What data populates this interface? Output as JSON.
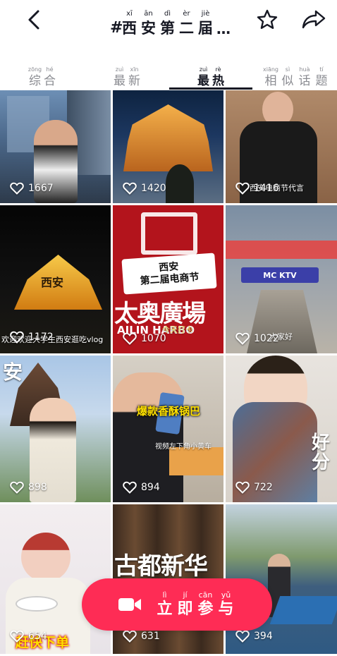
{
  "header": {
    "title": [
      {
        "py": "xī",
        "hz": "西"
      },
      {
        "py": "ān",
        "hz": "安"
      },
      {
        "py": "dì",
        "hz": "第"
      },
      {
        "py": "èr",
        "hz": "二"
      },
      {
        "py": "jiè",
        "hz": "届"
      }
    ],
    "hash": "#",
    "ellipsis": "…"
  },
  "tabs": [
    {
      "chars": [
        {
          "py": "zōng",
          "hz": "综"
        },
        {
          "py": "hé",
          "hz": "合"
        }
      ]
    },
    {
      "chars": [
        {
          "py": "zuì",
          "hz": "最"
        },
        {
          "py": "xīn",
          "hz": "新"
        }
      ]
    },
    {
      "chars": [
        {
          "py": "zuì",
          "hz": "最"
        },
        {
          "py": "rè",
          "hz": "热"
        }
      ],
      "active": true
    },
    {
      "chars": [
        {
          "py": "xiāng",
          "hz": "相"
        },
        {
          "py": "sì",
          "hz": "似"
        },
        {
          "py": "huà",
          "hz": "话"
        },
        {
          "py": "tí",
          "hz": "题"
        }
      ]
    }
  ],
  "videos": [
    {
      "likes": "1667"
    },
    {
      "likes": "1420"
    },
    {
      "likes": "1416",
      "overlay": "西安电商节代言"
    },
    {
      "likes": "1172",
      "overlay": "欢迎欢迎大学生西安逛吃vlog",
      "sign": "西安"
    },
    {
      "likes": "1070",
      "banner_line1": "西安",
      "banner_line2": "第二届电商节",
      "sign": "太奥廣場",
      "sign_en": "AILIN HARBO",
      "sub": "今天打卡"
    },
    {
      "likes": "1022",
      "overlay": "大家好",
      "sign": "MC KTV"
    },
    {
      "likes": "898",
      "sign": "安"
    },
    {
      "likes": "894",
      "caption": "爆款香酥锅巴",
      "overlay": "视频左下角小黄车"
    },
    {
      "likes": "722",
      "sign": "好 分"
    },
    {
      "likes": "654",
      "caption": "赶快下单"
    },
    {
      "likes": "631",
      "sign": "古都新华"
    },
    {
      "likes": "394"
    }
  ],
  "join_button": {
    "chars": [
      {
        "py": "lì",
        "hz": "立"
      },
      {
        "py": "jí",
        "hz": "即"
      },
      {
        "py": "cān",
        "hz": "参"
      },
      {
        "py": "yǔ",
        "hz": "与"
      }
    ]
  },
  "colors": {
    "accent": "#fe2c55",
    "text": "#161823",
    "muted": "#8a8b91"
  },
  "icons": {
    "back": "chevron-left-icon",
    "favorite": "star-outline-icon",
    "share": "share-arrow-icon",
    "like": "heart-outline-icon",
    "camera": "video-camera-icon"
  }
}
